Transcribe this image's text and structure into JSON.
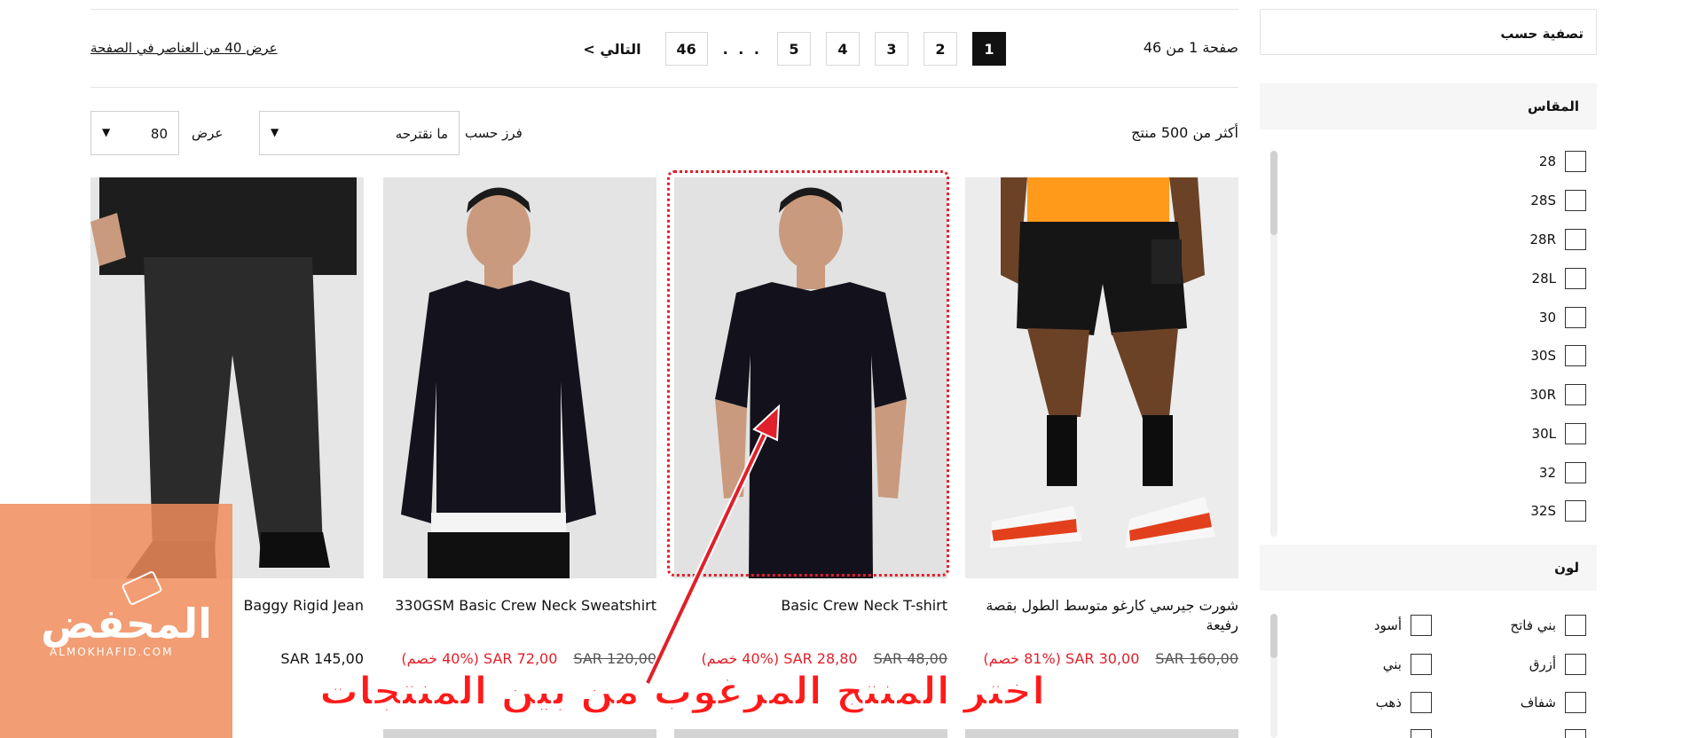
{
  "filters": {
    "title": "تصفية حسب",
    "size": {
      "heading": "المقاس",
      "options": [
        "28",
        "28S",
        "28R",
        "28L",
        "30",
        "30S",
        "30R",
        "30L",
        "32",
        "32S"
      ]
    },
    "color": {
      "heading": "لون",
      "right_column": [
        "بني فاتح",
        "أزرق",
        "شفاف"
      ],
      "left_column": [
        "أسود",
        "بني",
        "ذهب"
      ]
    }
  },
  "toolbar": {
    "page_info": "صفحة 1 من 46",
    "pages": [
      "1",
      "2",
      "3",
      "4",
      "5"
    ],
    "active_page": "1",
    "dots": ". . .",
    "last_page": "46",
    "next_label": "التالي >",
    "per_page_link": "عرض 40 من العناصر في الصفحة",
    "result_count": "أكثر من 500 منتج",
    "sort_label": "فرز حسب",
    "sort_value": "ما نقترحه",
    "show_label": "عرض",
    "show_value": "80"
  },
  "products": [
    {
      "name": "شورت جيرسي كارغو متوسط الطول بقصة رفيعة",
      "old_price": "SAR 160,00",
      "new_price": "SAR 30,00 (81% خصم)"
    },
    {
      "name": "Basic Crew Neck T-shirt",
      "old_price": "SAR 48,00",
      "new_price": "SAR 28,80 (40% خصم)"
    },
    {
      "name": "330GSM Basic Crew Neck Sweatshirt",
      "old_price": "SAR 120,00",
      "new_price": "SAR 72,00 (40% خصم)"
    },
    {
      "name": "Baggy Rigid Jean",
      "price": "SAR 145,00"
    }
  ],
  "overlay": {
    "logo_text": "المحفض",
    "logo_subtext": "ALMOKHAFID.COM",
    "annotation": "اختر المنتج المرغوب من بين المنتجات"
  },
  "colors": {
    "accent_red": "#e0202a",
    "active_page_bg": "#111111",
    "logo_orange": "#f08c5a"
  }
}
